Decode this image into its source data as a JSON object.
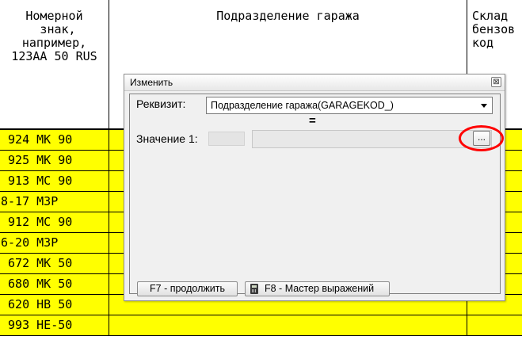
{
  "table": {
    "headers": {
      "plate": "Номерной\n знак,\nнапример,\n123АА 50 RUS",
      "division": "Подразделение гаража",
      "warehouse": "Склад\nбензов\nкод"
    },
    "rows": [
      {
        "plate": " 924 МК 90"
      },
      {
        "plate": " 925 МК 90"
      },
      {
        "plate": " 913 МС 90"
      },
      {
        "plate": "8-17 МЗР"
      },
      {
        "plate": " 912 МС 90"
      },
      {
        "plate": "6-20 МЗР"
      },
      {
        "plate": " 672 МК 50"
      },
      {
        "plate": " 680 МК 50"
      },
      {
        "plate": " 620 НВ 50"
      },
      {
        "plate": " 993 НЕ-50"
      }
    ],
    "row_color": "#ffff00"
  },
  "dialog": {
    "title": "Изменить",
    "close_glyph": "⊠",
    "requisite_label": "Реквизит:",
    "requisite_value": "Подразделение гаража(GARAGEKOD_)",
    "operator": "=",
    "value_label": "Значение 1:",
    "browse_label": "...",
    "continue_button": "F7 - продолжить",
    "expression_button": "F8 - Мастер выражений",
    "highlight_color": "#ff0000"
  }
}
